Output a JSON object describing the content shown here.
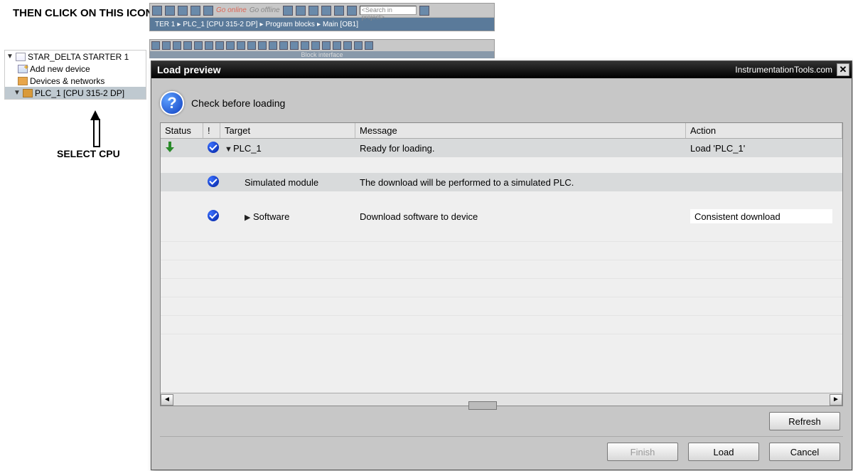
{
  "annotations": {
    "top": "THEN CLICK ON THIS ICON",
    "bottom": "SELECT CPU"
  },
  "toolbar": {
    "go_online": "Go online",
    "go_offline": "Go offline",
    "search_placeholder": "<Search in project>"
  },
  "breadcrumb": {
    "p0": "TER 1",
    "p1": "PLC_1 [CPU 315-2 DP]",
    "p2": "Program blocks",
    "p3": "Main [OB1]"
  },
  "block_interface_label": "Block interface",
  "tree": {
    "root": "STAR_DELTA STARTER 1",
    "add_device": "Add new device",
    "devices_networks": "Devices & networks",
    "plc": "PLC_1 [CPU 315-2 DP]"
  },
  "dialog": {
    "title": "Load preview",
    "watermark": "InstrumentationTools.com",
    "prompt": "Check before loading",
    "columns": {
      "status": "Status",
      "mark": "!",
      "target": "Target",
      "message": "Message",
      "action": "Action"
    },
    "rows": [
      {
        "status_icon": "download",
        "check": true,
        "expander": "▼",
        "indent": 0,
        "target": "PLC_1",
        "message": "Ready for loading.",
        "action": "Load 'PLC_1'",
        "action_editable": false,
        "alt": true
      },
      {
        "status_icon": "",
        "check": true,
        "expander": "",
        "indent": 1,
        "target": "Simulated module",
        "message": "The download will be performed to a simulated PLC.",
        "action": "",
        "action_editable": false,
        "alt": true
      },
      {
        "status_icon": "",
        "check": true,
        "expander": "▶",
        "indent": 1,
        "target": "Software",
        "message": "Download software to device",
        "action": "Consistent download",
        "action_editable": true,
        "alt": false
      }
    ],
    "buttons": {
      "refresh": "Refresh",
      "finish": "Finish",
      "load": "Load",
      "cancel": "Cancel"
    }
  }
}
